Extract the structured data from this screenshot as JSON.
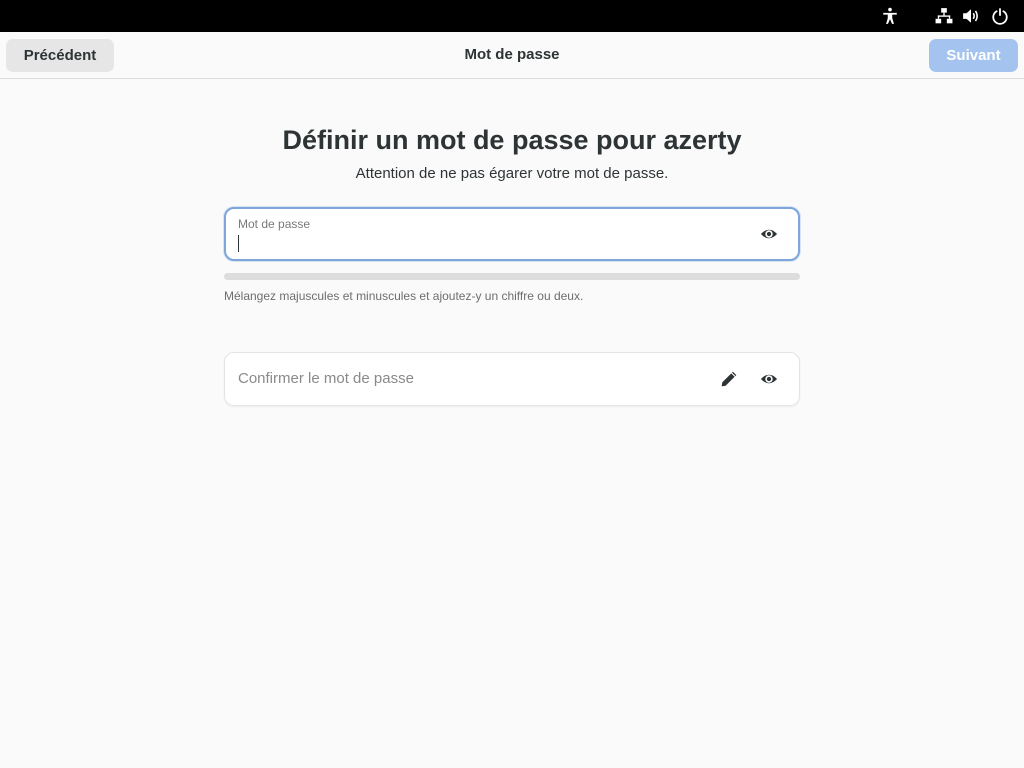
{
  "system_bar": {
    "icons": [
      "accessibility-icon",
      "network-wired-icon",
      "volume-icon",
      "power-icon"
    ]
  },
  "header": {
    "back_label": "Précédent",
    "title": "Mot de passe",
    "next_label": "Suivant"
  },
  "main": {
    "title": "Définir un mot de passe pour azerty",
    "subtitle": "Attention de ne pas égarer votre mot de passe.",
    "password_field": {
      "label": "Mot de passe",
      "value": ""
    },
    "strength": {
      "level": 0
    },
    "hint": "Mélangez majuscules et minuscules et ajoutez-y un chiffre ou deux.",
    "confirm_field": {
      "placeholder": "Confirmer le mot de passe",
      "value": ""
    }
  },
  "colors": {
    "accent": "#3584e4",
    "next_button_disabled": "#a4c4ef",
    "focus_border": "#7ea6da",
    "background": "#fafafa",
    "system_bar": "#000000"
  }
}
